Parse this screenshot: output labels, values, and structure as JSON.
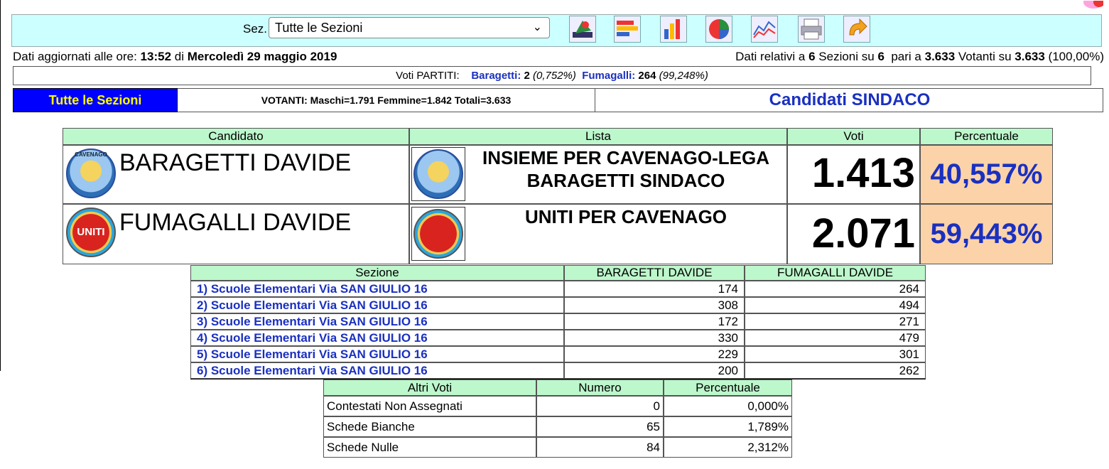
{
  "toolbar": {
    "sez_label": "Sez.",
    "select_value": "Tutte le Sezioni"
  },
  "info": {
    "left_prefix": "Dati aggiornati alle ore: ",
    "time": "13:52",
    "di": " di ",
    "date": "Mercoledì 29 maggio 2019",
    "right_p1": "Dati relativi a ",
    "sez_count": "6",
    "right_p2": " Sezioni su ",
    "sez_total": "6",
    "right_p3": "  pari a ",
    "votanti": "3.633",
    "right_p4": " Votanti su ",
    "votanti_total": "3.633",
    "percent": " (100,00%)"
  },
  "partiti": {
    "label": "Voti PARTITI:",
    "p1_name": "Baragetti:",
    "p1_votes": "2",
    "p1_perc": "(0,752%)",
    "p2_name": "Fumagalli:",
    "p2_votes": "264",
    "p2_perc": "(99,248%)"
  },
  "section_bar": {
    "button": "Tutte le Sezioni",
    "votanti": "VOTANTI: Maschi=1.791 Femmine=1.842 Totali=3.633",
    "title": "Candidati SINDACO"
  },
  "candidates": {
    "headers": [
      "Candidato",
      "Lista",
      "Voti",
      "Percentuale"
    ],
    "rows": [
      {
        "name": "BARAGETTI DAVIDE",
        "lista_line1": "INSIEME PER CAVENAGO-LEGA",
        "lista_line2": "BARAGETTI SINDACO",
        "votes": "1.413",
        "perc": "40,557%",
        "logo": "CAVENAGO"
      },
      {
        "name": "FUMAGALLI DAVIDE",
        "lista_line1": "UNITI PER CAVENAGO",
        "lista_line2": "",
        "votes": "2.071",
        "perc": "59,443%",
        "logo": "UNITI"
      }
    ]
  },
  "sezioni": {
    "headers": [
      "Sezione",
      "BARAGETTI DAVIDE",
      "FUMAGALLI DAVIDE"
    ],
    "rows": [
      {
        "name": "1) Scuole Elementari Via SAN GIULIO 16",
        "a": "174",
        "b": "264"
      },
      {
        "name": "2) Scuole Elementari Via SAN GIULIO 16",
        "a": "308",
        "b": "494"
      },
      {
        "name": "3) Scuole Elementari Via SAN GIULIO 16",
        "a": "172",
        "b": "271"
      },
      {
        "name": "4) Scuole Elementari Via SAN GIULIO 16",
        "a": "330",
        "b": "479"
      },
      {
        "name": "5) Scuole Elementari Via SAN GIULIO 16",
        "a": "229",
        "b": "301"
      },
      {
        "name": "6) Scuole Elementari Via SAN GIULIO 16",
        "a": "200",
        "b": "262"
      }
    ]
  },
  "altri_voti": {
    "headers": [
      "Altri Voti",
      "Numero",
      "Percentuale"
    ],
    "rows": [
      {
        "label": "Contestati Non Assegnati",
        "num": "0",
        "perc": "0,000%"
      },
      {
        "label": "Schede Bianche",
        "num": "65",
        "perc": "1,789%"
      },
      {
        "label": "Schede Nulle",
        "num": "84",
        "perc": "2,312%"
      }
    ]
  }
}
